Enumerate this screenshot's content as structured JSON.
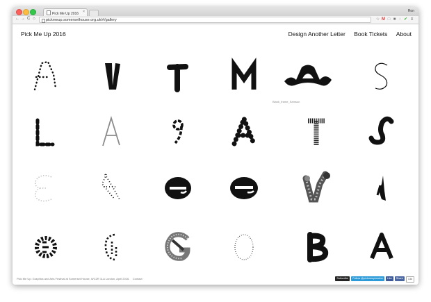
{
  "browser": {
    "tab_title": "Pick Me Up 2016",
    "tab_close": "×",
    "user_name": "Ron",
    "url": "pickmeup.somersethouse.org.uk/#/gallery",
    "nav": {
      "back": "←",
      "forward": "→",
      "reload": "C",
      "home": "⌂"
    },
    "extensions": [
      "☆",
      "M",
      "□",
      "■",
      "◌",
      "✔",
      "≡"
    ]
  },
  "site": {
    "brand": "Pick Me Up 2016",
    "menu": [
      "Design Another Letter",
      "Book Tickets",
      "About"
    ],
    "hover_caption": "Blank_frame_Samson"
  },
  "gallery": {
    "letters": [
      {
        "glyph": "A",
        "style": "dotted"
      },
      {
        "glyph": "V",
        "style": "heavy"
      },
      {
        "glyph": "T",
        "style": "rounded"
      },
      {
        "glyph": "M",
        "style": "bold"
      },
      {
        "glyph": "A",
        "style": "hat"
      },
      {
        "glyph": "S",
        "style": "thin"
      },
      {
        "glyph": "L",
        "style": "beads"
      },
      {
        "glyph": "A",
        "style": "grey-thin"
      },
      {
        "glyph": "9",
        "style": "swirl"
      },
      {
        "glyph": "A",
        "style": "balls"
      },
      {
        "glyph": "T",
        "style": "striped"
      },
      {
        "glyph": "S",
        "style": "worm"
      },
      {
        "glyph": "E",
        "style": "light-dotted"
      },
      {
        "glyph": "A",
        "style": "dotted"
      },
      {
        "glyph": "e",
        "style": "blob"
      },
      {
        "glyph": "e",
        "style": "blob"
      },
      {
        "glyph": "V",
        "style": "textured"
      },
      {
        "glyph": "I",
        "style": "wing"
      },
      {
        "glyph": "C",
        "style": "dashes"
      },
      {
        "glyph": "0",
        "style": "dash-ring"
      },
      {
        "glyph": "G",
        "style": "grey-ring"
      },
      {
        "glyph": "O",
        "style": "dotted-ring"
      },
      {
        "glyph": "B",
        "style": "solid"
      },
      {
        "glyph": "A",
        "style": "solid"
      }
    ]
  },
  "footer": {
    "text": "Pick Me Up: Graphics and Arts Festival at Somerset House, WC2R 1LA London, April 2016.",
    "contact": "Contact",
    "subscribe": "Subscribe",
    "follow": "Follow @pickmeuplondon",
    "like": "Like",
    "share": "Share",
    "count": "13k"
  },
  "colors": {
    "ink": "#111111",
    "grey_letter": "#8c8c8c",
    "twitter": "#2b9ad8",
    "facebook": "#3b5998"
  }
}
